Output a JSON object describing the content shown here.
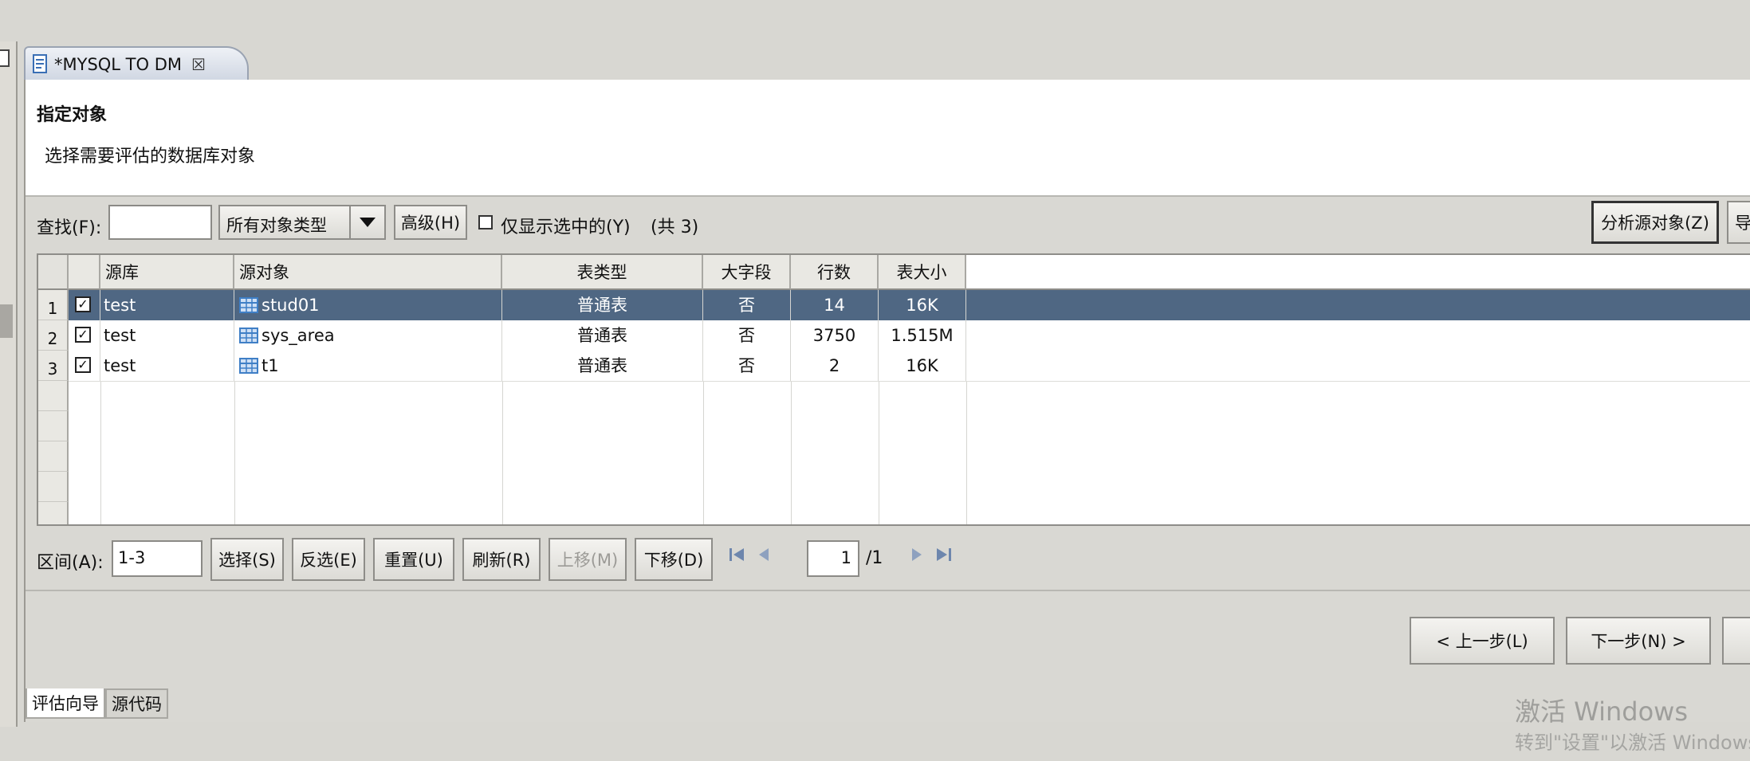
{
  "editor_tab": {
    "title": "*MYSQL TO DM",
    "close_glyph": "☒"
  },
  "header": {
    "title": "指定对象",
    "description": "选择需要评估的数据库对象"
  },
  "toolbar": {
    "find_label": "查找(F):",
    "find_value": "",
    "type_combo": "所有对象类型",
    "advanced_button": "高级(H)",
    "show_selected_label": "仅显示选中的(Y)",
    "total_text": "(共 3)",
    "analyze_button": "分析源对象(Z)",
    "next_button_partial": "导"
  },
  "table": {
    "columns": [
      "源库",
      "源对象",
      "表类型",
      "大字段",
      "行数",
      "表大小"
    ],
    "rows": [
      {
        "num": "1",
        "checked": true,
        "db": "test",
        "obj": "stud01",
        "type": "普通表",
        "lob": "否",
        "rows": "14",
        "size": "16K",
        "selected": true
      },
      {
        "num": "2",
        "checked": true,
        "db": "test",
        "obj": "sys_area",
        "type": "普通表",
        "lob": "否",
        "rows": "3750",
        "size": "1.515M",
        "selected": false
      },
      {
        "num": "3",
        "checked": true,
        "db": "test",
        "obj": "t1",
        "type": "普通表",
        "lob": "否",
        "rows": "2",
        "size": "16K",
        "selected": false
      }
    ]
  },
  "range_bar": {
    "range_label": "区间(A):",
    "range_value": "1-3",
    "select_button": "选择(S)",
    "invert_button": "反选(E)",
    "reset_button": "重置(U)",
    "refresh_button": "刷新(R)",
    "up_button": "上移(M)",
    "down_button": "下移(D)",
    "page_value": "1",
    "page_total": "/1"
  },
  "wizard": {
    "prev_button": "< 上一步(L)",
    "next_button": "下一步(N) >"
  },
  "bottom_tabs": [
    "评估向导",
    "源代码"
  ],
  "watermark": {
    "line1": "激活 Windows",
    "line2": "转到\"设置\"以激活 Windows"
  },
  "colors": {
    "selection": "#4f6783",
    "table_icon": "#3f7fc6"
  }
}
